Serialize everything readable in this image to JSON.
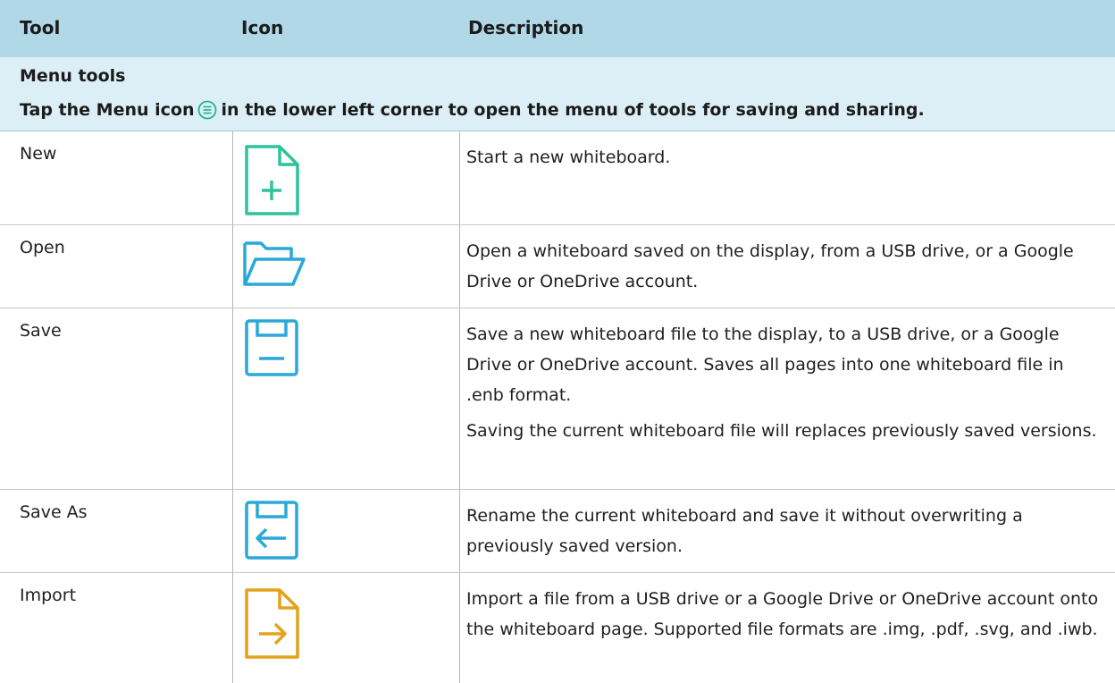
{
  "table": {
    "headers": {
      "tool": "Tool",
      "icon": "Icon",
      "description": "Description"
    },
    "section": {
      "title": "Menu tools",
      "note_before": "Tap the Menu icon",
      "note_after": "in the lower left corner to open the menu of tools for saving and sharing.",
      "note_icon": "menu-icon"
    },
    "rows": [
      {
        "tool": "New",
        "icon": "new-file-icon",
        "icon_color": "#2fc39a",
        "description": [
          "Start a new whiteboard."
        ]
      },
      {
        "tool": "Open",
        "icon": "folder-open-icon",
        "icon_color": "#2aa9d8",
        "description": [
          "Open a whiteboard saved on the display, from a USB drive, or a Google Drive or OneDrive account."
        ]
      },
      {
        "tool": "Save",
        "icon": "save-icon",
        "icon_color": "#2aa9d8",
        "description": [
          "Save a new whiteboard file to the display, to a USB drive, or a Google Drive or OneDrive account. Saves all pages into one whiteboard file in .enb format.",
          "Saving the current whiteboard file will replaces previously saved versions."
        ]
      },
      {
        "tool": "Save As",
        "icon": "save-as-icon",
        "icon_color": "#2aa9d8",
        "description": [
          "Rename the current whiteboard and save it without overwriting a previously saved version."
        ]
      },
      {
        "tool": "Import",
        "icon": "import-icon",
        "icon_color": "#e3a21a",
        "description": [
          "Import a file from a USB drive or a Google Drive or OneDrive account onto the whiteboard page. Supported file formats are .img, .pdf, .svg, and .iwb."
        ]
      }
    ]
  }
}
